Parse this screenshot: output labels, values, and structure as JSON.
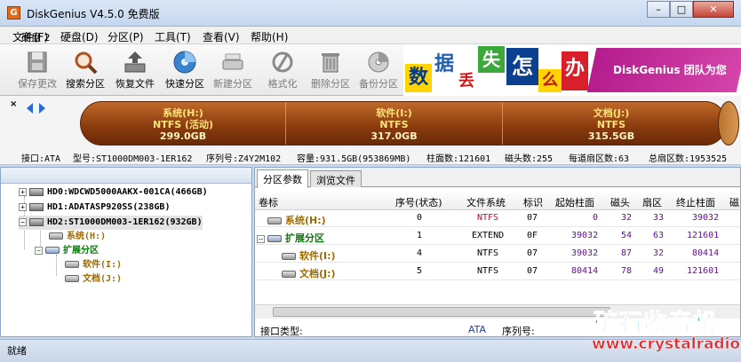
{
  "window": {
    "title": "DiskGenius V4.5.0 免费版",
    "app_icon": "G"
  },
  "menu": [
    "文件(F)",
    "硬盘(D)",
    "分区(P)",
    "工具(T)",
    "查看(V)",
    "帮助(H)"
  ],
  "toolbar": {
    "save": "保存更改",
    "search": "搜索分区",
    "restore": "恢复文件",
    "quick": "快速分区",
    "new": "新建分区",
    "format": "格式化",
    "delete": "删除分区",
    "backup": "备份分区"
  },
  "banner": {
    "tiles": [
      "数",
      "据",
      "丢",
      "失",
      "怎",
      "么",
      "办"
    ],
    "brand": "DiskGenius 团队为您"
  },
  "disk_map": {
    "nav_close": "×",
    "disk_label": "硬盘 2",
    "partitions": [
      {
        "name": "系统(H:)",
        "fs": "NTFS (活动)",
        "size": "299.0GB"
      },
      {
        "name": "软件(I:)",
        "fs": "NTFS",
        "size": "317.0GB"
      },
      {
        "name": "文档(J:)",
        "fs": "NTFS",
        "size": "315.5GB"
      }
    ]
  },
  "info": {
    "interface": "接口:ATA",
    "model": "型号:ST1000DM003-1ER162",
    "serial": "序列号:Z4Y2M102",
    "capacity": "容量:931.5GB(953869MB)",
    "cylinders": "柱面数:121601",
    "heads": "磁头数:255",
    "sectors_per_track": "每道扇区数:63",
    "total_sectors": "总扇区数:1953525"
  },
  "tree": {
    "disks": [
      "HD0:WDCWD5000AAKX-001CA(466GB)",
      "HD1:ADATASP920SS(238GB)",
      "HD2:ST1000DM003-1ER162(932GB)"
    ],
    "sys": "系统(H:)",
    "ext": "扩展分区",
    "soft": "软件(I:)",
    "doc": "文档(J:)"
  },
  "tabs": [
    "分区参数",
    "浏览文件"
  ],
  "columns": [
    "卷标",
    "序号(状态)",
    "文件系统",
    "标识",
    "起始柱面",
    "磁头",
    "扇区",
    "终止柱面",
    "磁"
  ],
  "rows": [
    {
      "name": "系统(H:)",
      "idx": "0",
      "fs": "NTFS",
      "id": "07",
      "start": "0",
      "head": "32",
      "sector": "33",
      "end": "39032"
    },
    {
      "name": "扩展分区",
      "idx": "1",
      "fs": "EXTEND",
      "id": "0F",
      "start": "39032",
      "head": "54",
      "sector": "63",
      "end": "121601"
    },
    {
      "name": "软件(I:)",
      "idx": "4",
      "fs": "NTFS",
      "id": "07",
      "start": "39032",
      "head": "87",
      "sector": "32",
      "end": "80414"
    },
    {
      "name": "文档(J:)",
      "idx": "5",
      "fs": "NTFS",
      "id": "07",
      "start": "80414",
      "head": "78",
      "sector": "49",
      "end": "121601"
    }
  ],
  "bottom": {
    "iface_label": "接口类型:",
    "iface_value": "ATA",
    "serial_label": "序列号:"
  },
  "status": "就绪",
  "watermark": {
    "title": "矿石收音机",
    "url": "www.crystalradio.cn"
  },
  "colors": {
    "partition_bar": "#8d3d0f",
    "partition_text": "#ffe37a",
    "name_color": "#a06a00",
    "fs_ntfs": "#b0102a",
    "num_color": "#6a0d9c"
  }
}
